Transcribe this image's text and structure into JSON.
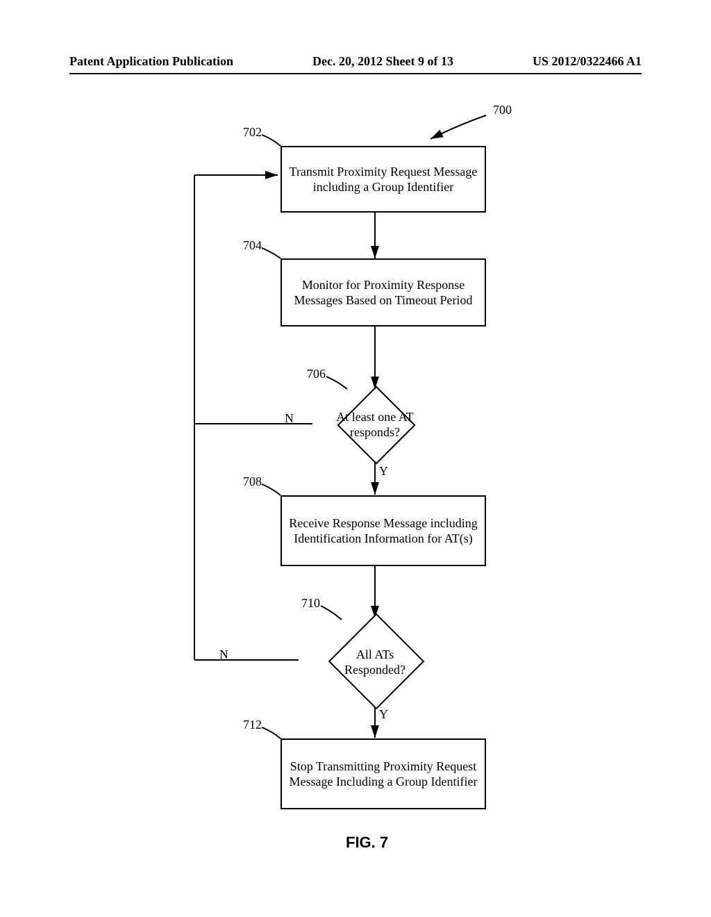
{
  "header": {
    "left": "Patent Application Publication",
    "center": "Dec. 20, 2012  Sheet 9 of 13",
    "right": "US 2012/0322466 A1"
  },
  "refs": {
    "r700": "700",
    "r702": "702",
    "r704": "704",
    "r706": "706",
    "r708": "708",
    "r710": "710",
    "r712": "712"
  },
  "boxes": {
    "b702": "Transmit Proximity Request Message including a Group Identifier",
    "b704": "Monitor for Proximity Response Messages Based on Timeout Period",
    "b708": "Receive Response Message including Identification Information for AT(s)",
    "b712": "Stop Transmitting Proximity Request Message Including a Group Identifier"
  },
  "diamonds": {
    "d706": "At least one AT responds?",
    "d710": "All ATs Responded?"
  },
  "labels": {
    "y": "Y",
    "n": "N"
  },
  "figure": "FIG. 7"
}
